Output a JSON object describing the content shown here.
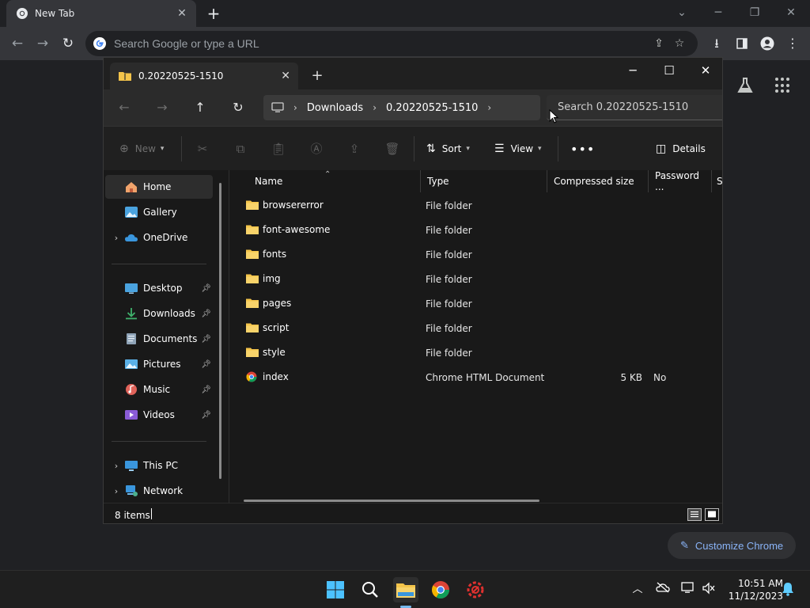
{
  "chrome": {
    "tab_title": "New Tab",
    "omnibox_placeholder": "Search Google or type a URL",
    "customize_label": "Customize Chrome"
  },
  "explorer": {
    "tab_title": "0.20220525-1510",
    "breadcrumb": [
      "Downloads",
      "0.20220525-1510"
    ],
    "search_placeholder": "Search 0.20220525-1510",
    "commands": {
      "new": "New",
      "sort": "Sort",
      "view": "View",
      "details": "Details"
    },
    "nav": {
      "top": [
        {
          "label": "Home",
          "icon": "home-icon"
        },
        {
          "label": "Gallery",
          "icon": "gallery-icon"
        },
        {
          "label": "OneDrive",
          "icon": "cloud-icon"
        }
      ],
      "pinned": [
        {
          "label": "Desktop",
          "icon": "desktop-icon"
        },
        {
          "label": "Downloads",
          "icon": "download-icon"
        },
        {
          "label": "Documents",
          "icon": "document-icon"
        },
        {
          "label": "Pictures",
          "icon": "pictures-icon"
        },
        {
          "label": "Music",
          "icon": "music-icon"
        },
        {
          "label": "Videos",
          "icon": "video-icon"
        }
      ],
      "bottom": [
        {
          "label": "This PC",
          "icon": "computer-icon"
        },
        {
          "label": "Network",
          "icon": "network-icon"
        }
      ]
    },
    "columns": {
      "name": "Name",
      "type": "Type",
      "compressed": "Compressed size",
      "password": "Password ...",
      "size": "Si"
    },
    "files": [
      {
        "name": "browsererror",
        "type": "File folder",
        "size": "",
        "password": ""
      },
      {
        "name": "font-awesome",
        "type": "File folder",
        "size": "",
        "password": ""
      },
      {
        "name": "fonts",
        "type": "File folder",
        "size": "",
        "password": ""
      },
      {
        "name": "img",
        "type": "File folder",
        "size": "",
        "password": ""
      },
      {
        "name": "pages",
        "type": "File folder",
        "size": "",
        "password": ""
      },
      {
        "name": "script",
        "type": "File folder",
        "size": "",
        "password": ""
      },
      {
        "name": "style",
        "type": "File folder",
        "size": "",
        "password": ""
      },
      {
        "name": "index",
        "type": "Chrome HTML Document",
        "size": "5 KB",
        "password": "No"
      }
    ],
    "status": "8 items"
  },
  "taskbar": {
    "time": "10:51 AM",
    "date": "11/12/2023"
  },
  "colors": {
    "folder": "#f4c44a",
    "chrome_link": "#8ab4f8",
    "accent": "#76b9ed"
  }
}
